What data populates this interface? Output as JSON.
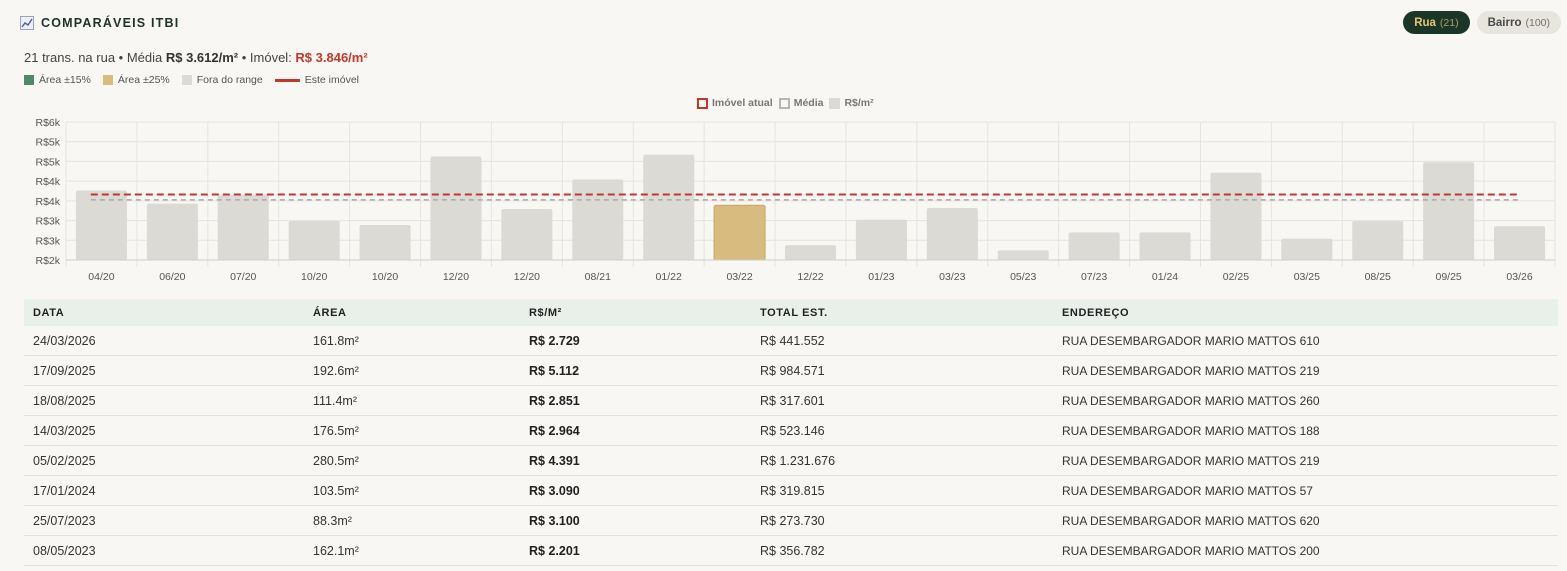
{
  "header": {
    "title": "COMPARÁVEIS ITBI",
    "icon": "chart-icon"
  },
  "toggles": [
    {
      "label": "Rua",
      "count": "(21)",
      "active": true
    },
    {
      "label": "Bairro",
      "count": "(100)",
      "active": false
    }
  ],
  "summary": {
    "prefix": "21 trans. na rua • Média ",
    "media": "R$ 3.612/m²",
    "mid": " • Imóvel: ",
    "imovel": "R$ 3.846/m²"
  },
  "legend": [
    {
      "label": "Área ±15%",
      "color": "#4e8a6a"
    },
    {
      "label": "Área ±25%",
      "color": "#d8bc7f"
    },
    {
      "label": "Fora do range",
      "color": "#dcdad5"
    },
    {
      "label": "Este imóvel",
      "color": "#c0392b"
    }
  ],
  "chart_legend": [
    {
      "label": "Imóvel atual"
    },
    {
      "label": "Média"
    },
    {
      "label": "R$/m²"
    }
  ],
  "chart_data": {
    "type": "bar",
    "categories": [
      "04/20",
      "06/20",
      "07/20",
      "10/20",
      "10/20",
      "12/20",
      "12/20",
      "08/21",
      "01/22",
      "03/22",
      "12/22",
      "01/23",
      "03/23",
      "05/23",
      "07/23",
      "01/24",
      "02/25",
      "03/25",
      "08/25",
      "09/25",
      "03/26"
    ],
    "values": [
      4020,
      3450,
      3820,
      2700,
      2520,
      5500,
      3220,
      4500,
      5580,
      3380,
      1640,
      2750,
      3260,
      1420,
      2200,
      2200,
      4800,
      1930,
      2690,
      5250,
      2470
    ],
    "highlight": [
      9
    ],
    "y_tick_labels": [
      "R$2k",
      "R$3k",
      "R$3k",
      "R$4k",
      "R$4k",
      "R$5k",
      "R$5k",
      "R$6k"
    ],
    "ylim": [
      1000,
      7000
    ],
    "series": [
      {
        "name": "R$/m²"
      }
    ],
    "imovel_atual": 3846,
    "media": 3612,
    "colors": {
      "bar": "#dcdad5",
      "highlight": "#d8bc7f",
      "imovel": "#c0392b",
      "media": "#a9a9a9"
    },
    "grid": true
  },
  "table": {
    "headers": [
      "DATA",
      "ÁREA",
      "R$/M²",
      "TOTAL EST.",
      "ENDEREÇO"
    ],
    "rows": [
      [
        "24/03/2026",
        "161.8m²",
        "R$ 2.729",
        "R$ 441.552",
        "RUA DESEMBARGADOR MARIO MATTOS 610"
      ],
      [
        "17/09/2025",
        "192.6m²",
        "R$ 5.112",
        "R$ 984.571",
        "RUA DESEMBARGADOR MARIO MATTOS 219"
      ],
      [
        "18/08/2025",
        "111.4m²",
        "R$ 2.851",
        "R$ 317.601",
        "RUA DESEMBARGADOR MARIO MATTOS 260"
      ],
      [
        "14/03/2025",
        "176.5m²",
        "R$ 2.964",
        "R$ 523.146",
        "RUA DESEMBARGADOR MARIO MATTOS 188"
      ],
      [
        "05/02/2025",
        "280.5m²",
        "R$ 4.391",
        "R$ 1.231.676",
        "RUA DESEMBARGADOR MARIO MATTOS 219"
      ],
      [
        "17/01/2024",
        "103.5m²",
        "R$ 3.090",
        "R$ 319.815",
        "RUA DESEMBARGADOR MARIO MATTOS 57"
      ],
      [
        "25/07/2023",
        "88.3m²",
        "R$ 3.100",
        "R$ 273.730",
        "RUA DESEMBARGADOR MARIO MATTOS 620"
      ],
      [
        "08/05/2023",
        "162.1m²",
        "R$ 2.201",
        "R$ 356.782",
        "RUA DESEMBARGADOR MARIO MATTOS 200"
      ]
    ]
  }
}
